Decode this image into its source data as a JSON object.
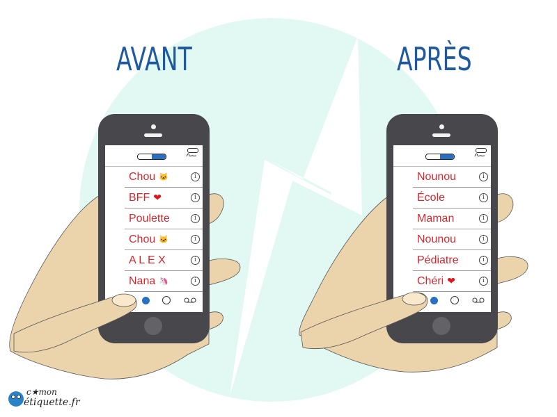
{
  "headings": {
    "before": "AVANT",
    "after": "APRÈS"
  },
  "colors": {
    "background_circle": "#e1f8f3",
    "heading": "#1f5aa0",
    "contact_text": "#d8262d",
    "phone_body": "#48474b",
    "accent_blue": "#2a6fc0",
    "skin": "#ebd4ac"
  },
  "phones": {
    "before": {
      "contacts": [
        {
          "name": "Chou",
          "emoji": "🐱"
        },
        {
          "name": "BFF",
          "emoji": "❤"
        },
        {
          "name": "Poulette",
          "emoji": ""
        },
        {
          "name": "Chou",
          "emoji": "🐱"
        },
        {
          "name": "A L E X",
          "emoji": ""
        },
        {
          "name": "Nana",
          "emoji": "🦄"
        }
      ]
    },
    "after": {
      "contacts": [
        {
          "name": "Nounou",
          "emoji": ""
        },
        {
          "name": "École",
          "emoji": ""
        },
        {
          "name": "Maman",
          "emoji": ""
        },
        {
          "name": "Nounou",
          "emoji": ""
        },
        {
          "name": "Pédiatre",
          "emoji": ""
        },
        {
          "name": "Chéri",
          "emoji": "❤"
        }
      ]
    }
  },
  "info_glyph": "i",
  "icons": {
    "info": "info-circle-icon",
    "tab_recents": "clock-icon",
    "tab_contacts": "headset-icon",
    "tab_voicemail": "voicemail-icon"
  },
  "logo": {
    "top_text": "c★mon",
    "text": "étiquette.fr"
  }
}
